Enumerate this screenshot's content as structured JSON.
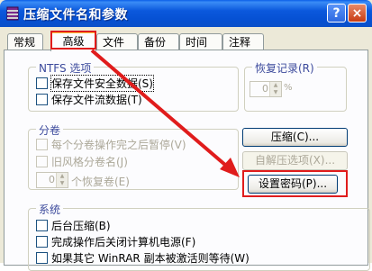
{
  "window": {
    "title": "压缩文件名和参数",
    "help_label": "?",
    "close_label": "×"
  },
  "tabs": [
    {
      "label": "常规"
    },
    {
      "label": "高级",
      "active": true
    },
    {
      "label": "文件"
    },
    {
      "label": "备份"
    },
    {
      "label": "时间"
    },
    {
      "label": "注释"
    }
  ],
  "ntfs": {
    "title": "NTFS 选项",
    "options": [
      {
        "label": "保存文件安全数据(S)",
        "checked": false
      },
      {
        "label": "保存文件流数据(T)",
        "checked": false
      }
    ]
  },
  "recovery": {
    "title": "恢复记录(R)",
    "value": "0",
    "unit": "%"
  },
  "volume": {
    "title": "分卷",
    "options": [
      {
        "label": "每个分卷操作完之后暂停(V)",
        "checked": false
      },
      {
        "label": "旧风格分卷名(J)",
        "checked": false
      }
    ],
    "recovery_volumes_value": "0",
    "recovery_volumes_label": "个恢复卷(E)"
  },
  "buttons": {
    "compression": "压缩(C)...",
    "sfx_options": "自解压选项(X)...",
    "set_password": "设置密码(P)..."
  },
  "system": {
    "title": "系统",
    "options": [
      {
        "label": "后台压缩(B)",
        "checked": false
      },
      {
        "label": "完成操作后关闭计算机电源(F)",
        "checked": false
      },
      {
        "label": "如果其它 WinRAR 副本被激活则等待(W)",
        "checked": false
      }
    ]
  },
  "colors": {
    "title_bar": "#0651d4",
    "highlight": "#e01c1c",
    "dialog_bg": "#ece9d8"
  }
}
